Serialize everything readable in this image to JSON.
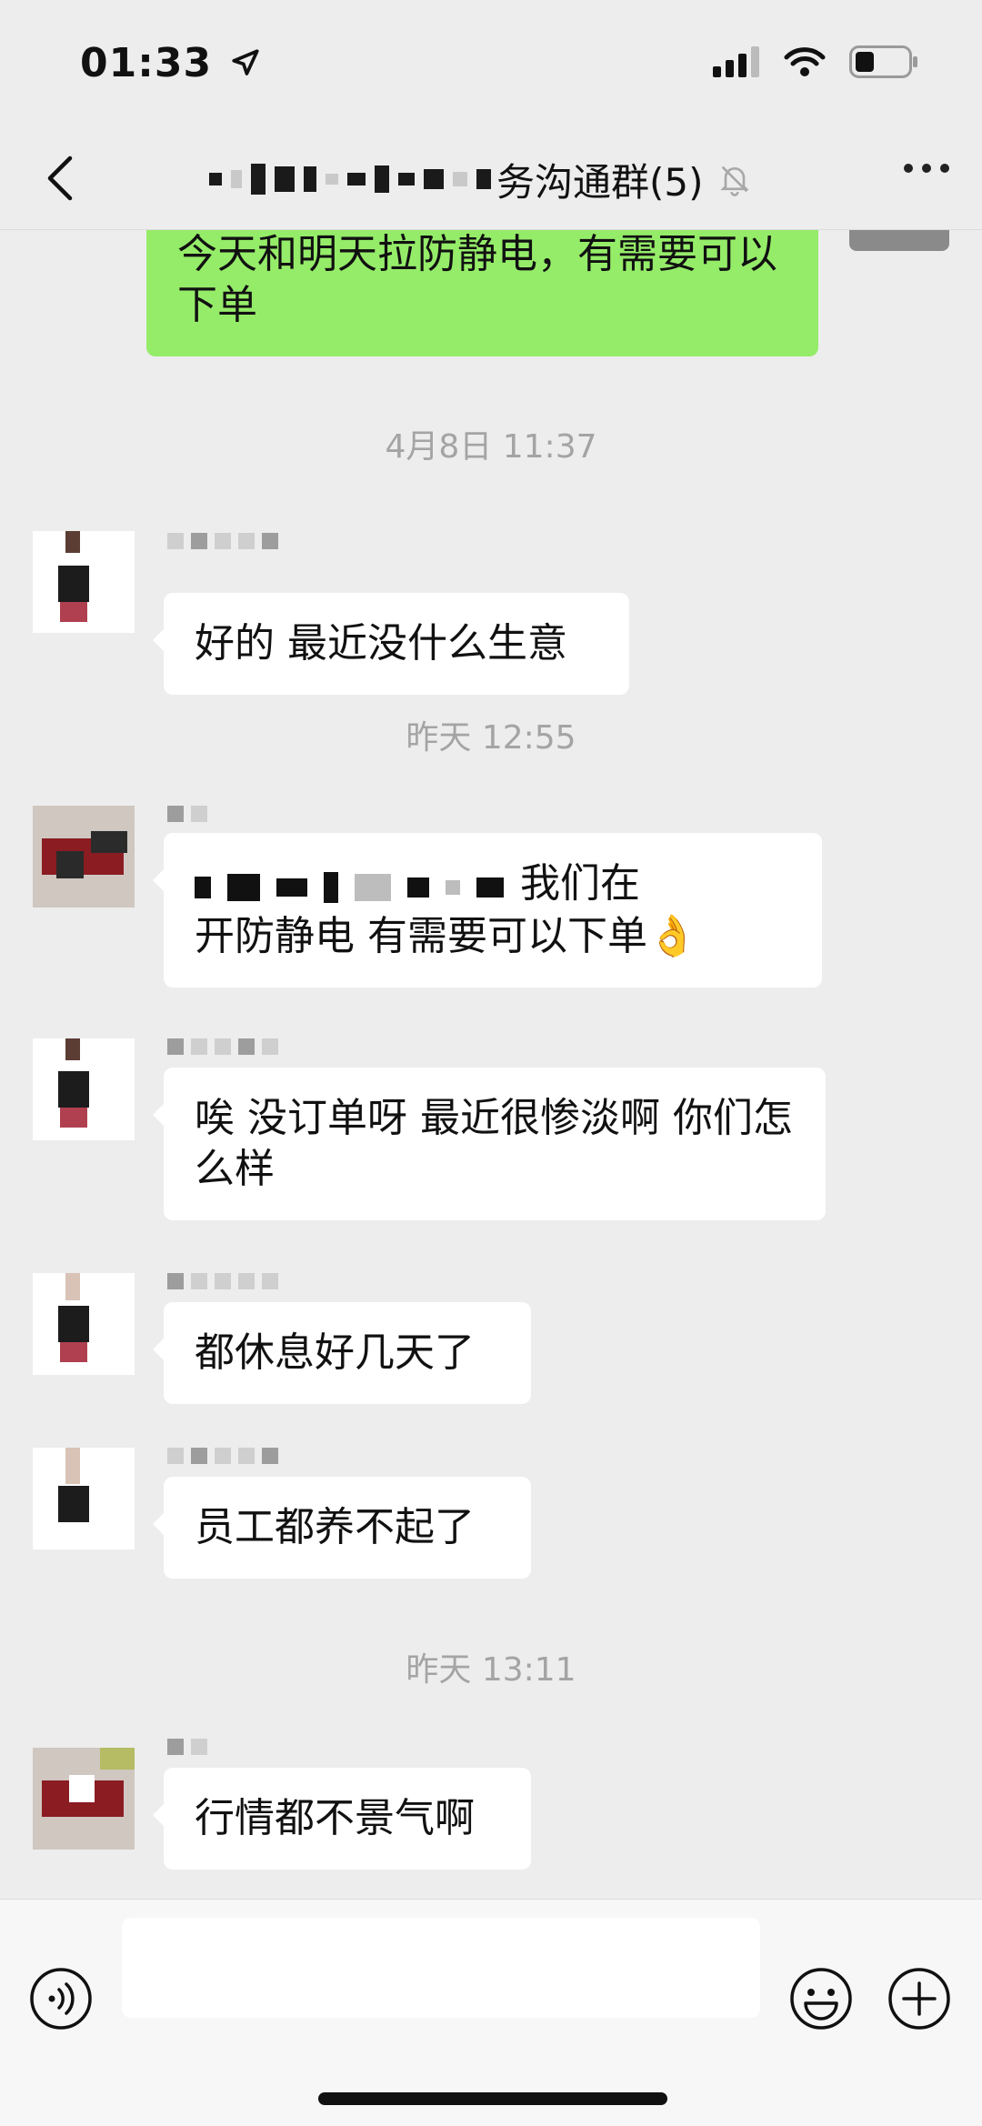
{
  "status_bar": {
    "time": "01:33"
  },
  "header": {
    "title_suffix": "务沟通群(5)"
  },
  "chat": {
    "first_message": "今天和明天拉防静电，有需要可以下单",
    "messages": [
      {
        "timestamp": "4月8日 11:37",
        "text": "好的 最近没什么生意"
      },
      {
        "timestamp": "昨天 12:55",
        "text_part1": "我们在",
        "text_part2": "开防静电 有需要可以下单👌"
      },
      {
        "text": "唉 没订单呀 最近很惨淡啊 你们怎么样"
      },
      {
        "text": "都休息好几天了"
      },
      {
        "text": "员工都养不起了"
      },
      {
        "timestamp": "昨天 13:11",
        "text": "行情都不景气啊"
      }
    ]
  },
  "input": {
    "value": ""
  }
}
